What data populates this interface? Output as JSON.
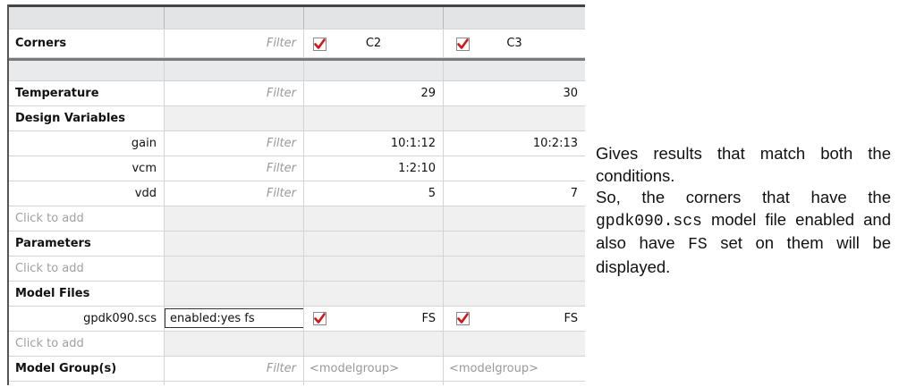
{
  "table": {
    "corners_label": "Corners",
    "filter_placeholder": "Filter",
    "columns": [
      {
        "name": "C2",
        "checked": true
      },
      {
        "name": "C3",
        "checked": true
      }
    ],
    "temperature": {
      "label": "Temperature",
      "values": [
        "29",
        "30"
      ]
    },
    "design_variables": {
      "label": "Design Variables",
      "rows": [
        {
          "name": "gain",
          "values": [
            "10:1:12",
            "10:2:13"
          ]
        },
        {
          "name": "vcm",
          "values": [
            "1:2:10",
            ""
          ]
        },
        {
          "name": "vdd",
          "values": [
            "5",
            "7"
          ]
        }
      ],
      "click_to_add": "Click to add"
    },
    "parameters": {
      "label": "Parameters",
      "click_to_add": "Click to add"
    },
    "model_files": {
      "label": "Model Files",
      "file": "gpdk090.scs",
      "filter_value": "enabled:yes fs",
      "values": [
        "FS",
        "FS"
      ],
      "checked": [
        true,
        true
      ],
      "click_to_add": "Click to add"
    },
    "model_groups": {
      "label": "Model Group(s)",
      "values": [
        "<modelgroup>",
        "<modelgroup>"
      ]
    }
  },
  "explanation": {
    "line1": "Gives results that match both the conditions.",
    "line2_start": "So, the corners that have the",
    "code1": "gpdk090.scs",
    "line2_mid": "model file enabled and also have",
    "code2": "FS",
    "line2_end": "set on them will be displayed."
  },
  "colors": {
    "checkmark": "#d01818",
    "header": "#e2e4e6",
    "grid_line": "#d4d4d4"
  }
}
